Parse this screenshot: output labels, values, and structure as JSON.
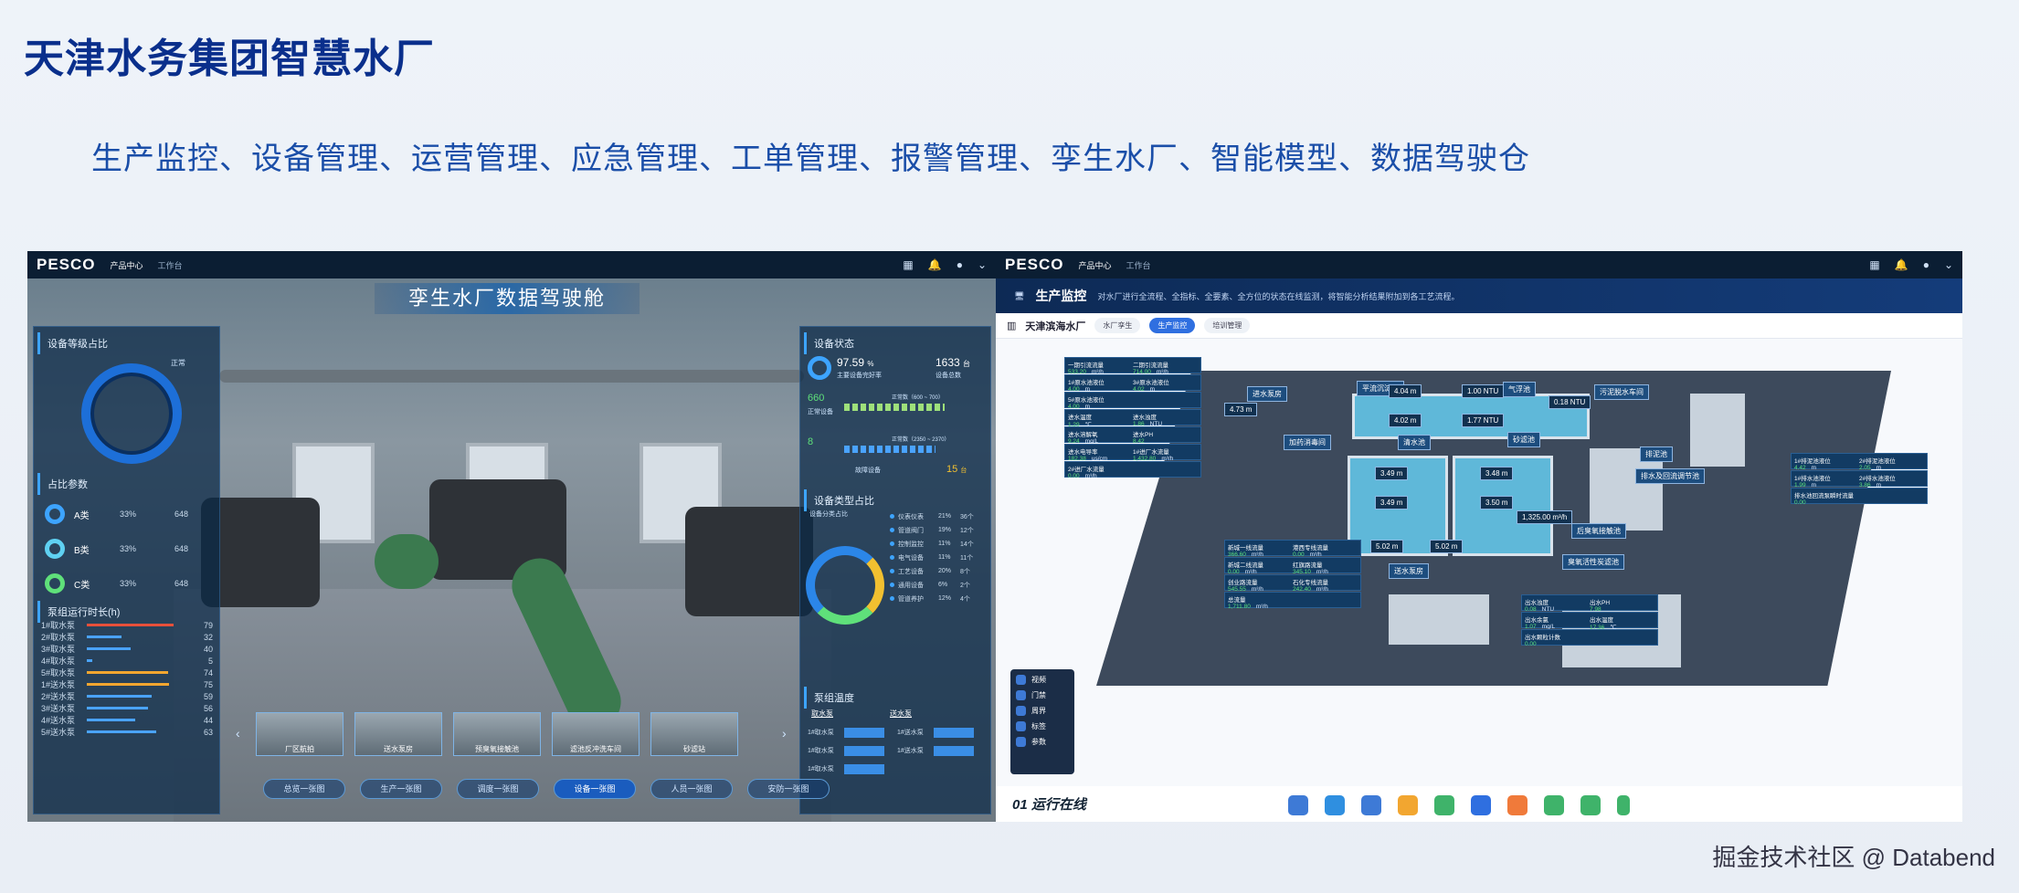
{
  "slide": {
    "title": "天津水务集团智慧水厂",
    "subtitle": "生产监控、设备管理、运营管理、应急管理、工单管理、报警管理、孪生水厂、智能模型、数据驾驶仓",
    "footer": "掘金技术社区 @ Databend"
  },
  "left": {
    "logo": "PESCO",
    "tabs": [
      "产品中心",
      "工作台"
    ],
    "title": "孪生水厂数据驾驶舱",
    "device_level": {
      "title": "设备等级占比",
      "normal": "正常",
      "param_title": "占比参数",
      "classes": [
        {
          "name": "A类",
          "pct": "33%",
          "count": "648"
        },
        {
          "name": "B类",
          "pct": "33%",
          "count": "648"
        },
        {
          "name": "C类",
          "pct": "33%",
          "count": "648"
        }
      ]
    },
    "pump_runtime": {
      "title": "泵组运行时长(h)",
      "rows": [
        {
          "name": "1#取水泵",
          "value": "79",
          "ratio": 0.79,
          "color": "#e8503a"
        },
        {
          "name": "2#取水泵",
          "value": "32",
          "ratio": 0.32,
          "color": "#4aa3ff"
        },
        {
          "name": "3#取水泵",
          "value": "40",
          "ratio": 0.4,
          "color": "#4aa3ff"
        },
        {
          "name": "4#取水泵",
          "value": "5",
          "ratio": 0.05,
          "color": "#4aa3ff"
        },
        {
          "name": "5#取水泵",
          "value": "74",
          "ratio": 0.74,
          "color": "#f2a630"
        },
        {
          "name": "1#送水泵",
          "value": "75",
          "ratio": 0.75,
          "color": "#f2a630"
        },
        {
          "name": "2#送水泵",
          "value": "59",
          "ratio": 0.59,
          "color": "#4aa3ff"
        },
        {
          "name": "3#送水泵",
          "value": "56",
          "ratio": 0.56,
          "color": "#4aa3ff"
        },
        {
          "name": "4#送水泵",
          "value": "44",
          "ratio": 0.44,
          "color": "#4aa3ff"
        },
        {
          "name": "5#送水泵",
          "value": "63",
          "ratio": 0.63,
          "color": "#4aa3ff"
        }
      ]
    },
    "device_status": {
      "title": "设备状态",
      "rate": "97.59",
      "rate_unit": "%",
      "rate_label": "主要设备完好率",
      "total": "1633",
      "total_unit": "台",
      "total_label": "设备总数",
      "normal_count": "660",
      "normal_label": "正常设备",
      "normal_range": "正常数（600 ~ 700）",
      "warn_count": "8",
      "warn_range": "正常数（2350 ~ 2370）",
      "fault_label": "故障设备",
      "fault_count": "15",
      "fault_unit": "台"
    },
    "device_type": {
      "title": "设备类型占比",
      "subtitle": "设备分类占比",
      "items": [
        {
          "name": "仪表仪表",
          "pct": "21%",
          "count": "36个"
        },
        {
          "name": "管道阀门",
          "pct": "19%",
          "count": "12个"
        },
        {
          "name": "控制监控",
          "pct": "11%",
          "count": "14个"
        },
        {
          "name": "电气设备",
          "pct": "11%",
          "count": "11个"
        },
        {
          "name": "工艺设备",
          "pct": "20%",
          "count": "8个"
        },
        {
          "name": "通用设备",
          "pct": "6%",
          "count": "2个"
        },
        {
          "name": "管道养护",
          "pct": "12%",
          "count": "4个"
        }
      ]
    },
    "pump_temp": {
      "title": "泵组温度",
      "head1": "取水泵",
      "head2": "送水泵",
      "rows": [
        [
          "1#取水泵",
          "1#送水泵"
        ],
        [
          "1#取水泵",
          "1#送水泵"
        ],
        [
          "1#取水泵",
          ""
        ]
      ]
    },
    "thumbs": [
      "厂区航拍",
      "送水泵房",
      "预臭氧接触池",
      "滤池反冲洗车间",
      "砂滤站"
    ],
    "nav": [
      "总览一张图",
      "生产一张图",
      "调度一张图",
      "设备一张图",
      "人员一张图",
      "安防一张图"
    ]
  },
  "right": {
    "logo": "PESCO",
    "tabs": [
      "产品中心",
      "工作台"
    ],
    "header_title": "生产监控",
    "header_desc": "对水厂进行全流程、全指标、全要素、全方位的状态在线监测，将智能分析结果附加到各工艺流程。",
    "plant": "天津滨海水厂",
    "pills": [
      "水厂孪生",
      "生产监控",
      "培训管理"
    ],
    "left_cards": [
      {
        "a": "一期引流流量",
        "av": "533.20",
        "au": "m³/h",
        "b": "二期引流流量",
        "bv": "714.00",
        "bu": "m³/h"
      },
      {
        "a": "1#原水池液位",
        "av": "4.00",
        "au": "m",
        "b": "3#原水池液位",
        "bv": "4.02",
        "bu": "m"
      },
      {
        "a": "5#原水池液位",
        "av": "4.00",
        "au": "m",
        "b": "",
        "bv": "",
        "bu": ""
      },
      {
        "a": "进水温度",
        "av": "1.29",
        "au": "℃",
        "b": "进水浊度",
        "bv": "1.86",
        "bu": "NTU"
      },
      {
        "a": "进水溶解氧",
        "av": "9.24",
        "au": "mg/L",
        "b": "进水PH",
        "bv": "8.42",
        "bu": ""
      },
      {
        "a": "进水电导率",
        "av": "182.38",
        "au": "us/cm",
        "b": "1#进厂水流量",
        "bv": "1,432.80",
        "bu": "m³/h"
      },
      {
        "a": "2#进厂水流量",
        "av": "0.00",
        "au": "m³/h",
        "b": "",
        "bv": "",
        "bu": ""
      }
    ],
    "bottom_cards": [
      {
        "a": "新城一线流量",
        "av": "366.60",
        "au": "m³/h",
        "b": "港西专线流量",
        "bv": "0.00",
        "bu": "m³/h"
      },
      {
        "a": "新城二线流量",
        "av": "0.00",
        "au": "m³/h",
        "b": "红旗路流量",
        "bv": "345.10",
        "bu": "m³/h"
      },
      {
        "a": "创业路流量",
        "av": "545.55",
        "au": "m³/h",
        "b": "石化专线流量",
        "bv": "242.40",
        "bu": "m³/h"
      },
      {
        "a": "总流量",
        "av": "1,711.80",
        "au": "m³/h",
        "b": "",
        "bv": "",
        "bu": ""
      }
    ],
    "out_cards": [
      {
        "a": "出水浊度",
        "av": "0.08",
        "au": "NTU",
        "b": "出水PH",
        "bv": "7.98",
        "bu": ""
      },
      {
        "a": "出水余氯",
        "av": "1.07",
        "au": "mg/L",
        "b": "出水温度",
        "bv": "17.36",
        "bu": "℃"
      },
      {
        "a": "出水颗粒计数",
        "av": "0.00",
        "au": "",
        "b": "",
        "bv": "",
        "bu": ""
      }
    ],
    "right_cards": [
      {
        "a": "1#排泥池液位",
        "av": "4.42",
        "au": "m",
        "b": "2#排泥池液位",
        "bv": "2.05",
        "bu": "m"
      },
      {
        "a": "1#排水池液位",
        "av": "1.99",
        "au": "m",
        "b": "2#排水池液位",
        "bv": "3.86",
        "bu": "m"
      },
      {
        "a": "排水池回流泵瞬时流量",
        "av": "0.00",
        "au": "",
        "b": "",
        "bv": "",
        "bu": ""
      }
    ],
    "labels": [
      "进水泵房",
      "平流沉淀池",
      "气浮池",
      "污泥脱水车间",
      "加药消毒间",
      "清水池",
      "砂滤池",
      "排泥池",
      "排水及回流调节池",
      "后臭氧接触池",
      "臭氧活性炭滤池",
      "送水泵房"
    ],
    "readouts": [
      "4.04 m",
      "1.00 NTU",
      "0.18 NTU",
      "4.73 m",
      "4.02 m",
      "1.77 NTU",
      "3.49 m",
      "3.48 m",
      "3.49 m",
      "3.50 m",
      "1,325.00 m³/h",
      "5.02 m",
      "5.02 m"
    ],
    "legend": [
      "视频",
      "门禁",
      "周界",
      "标签",
      "参数"
    ],
    "run_status": "01 运行在线"
  }
}
